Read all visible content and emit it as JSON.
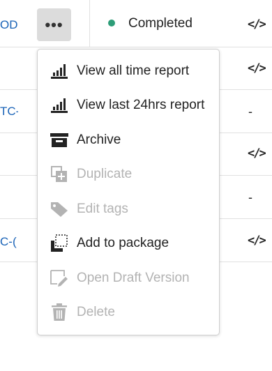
{
  "table": {
    "rows": [
      {
        "name": "OD",
        "end": "</>"
      },
      {
        "name": "",
        "end": "</>"
      },
      {
        "name": "TC-",
        "end": "-"
      },
      {
        "name": "",
        "end": "</>"
      },
      {
        "name": "",
        "end": "-"
      },
      {
        "name": "C-(",
        "end": "</>"
      }
    ],
    "status": "Completed",
    "more_label": "•••"
  },
  "colors": {
    "status_completed": "#2d9d78",
    "link": "#1a63b7",
    "disabled_text": "#b3b3b3"
  },
  "menu": {
    "items": [
      {
        "label": "View all time report",
        "icon": "bar-chart-icon",
        "enabled": true
      },
      {
        "label": "View last 24hrs report",
        "icon": "bar-chart-icon",
        "enabled": true
      },
      {
        "label": "Archive",
        "icon": "archive-icon",
        "enabled": true
      },
      {
        "label": "Duplicate",
        "icon": "duplicate-icon",
        "enabled": false
      },
      {
        "label": "Edit tags",
        "icon": "tag-icon",
        "enabled": false
      },
      {
        "label": "Add to package",
        "icon": "add-to-package-icon",
        "enabled": true
      },
      {
        "label": "Open Draft Version",
        "icon": "draft-edit-icon",
        "enabled": false
      },
      {
        "label": "Delete",
        "icon": "trash-icon",
        "enabled": false
      }
    ]
  }
}
